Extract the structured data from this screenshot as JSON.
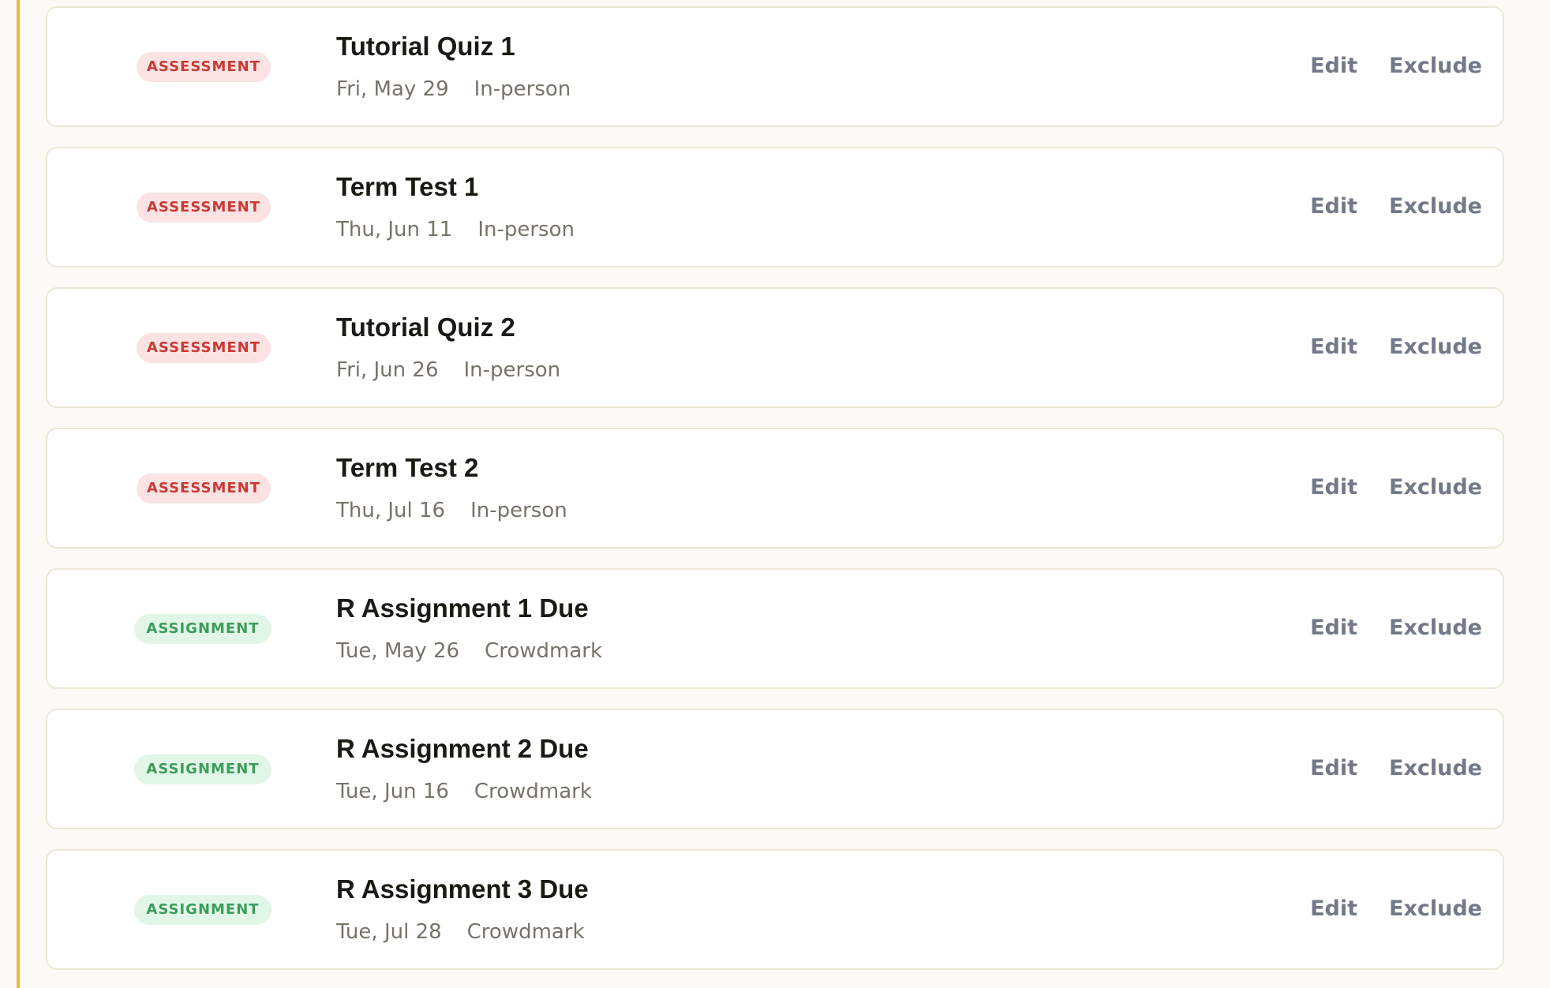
{
  "colors": {
    "accent_rule": "#e6bd3f",
    "assessment_badge_bg": "#fbe3e4",
    "assessment_badge_text": "#c93a34",
    "assignment_badge_bg": "#e2f6e8",
    "assignment_badge_text": "#3b9d5a",
    "action_text": "#727988"
  },
  "events": [
    {
      "type": "assessment",
      "badge": "ASSESSMENT",
      "title": "Tutorial Quiz 1",
      "date": "Fri, May 29",
      "location": "In-person",
      "edit_label": "Edit",
      "exclude_label": "Exclude"
    },
    {
      "type": "assessment",
      "badge": "ASSESSMENT",
      "title": "Term Test 1",
      "date": "Thu, Jun 11",
      "location": "In-person",
      "edit_label": "Edit",
      "exclude_label": "Exclude"
    },
    {
      "type": "assessment",
      "badge": "ASSESSMENT",
      "title": "Tutorial Quiz 2",
      "date": "Fri, Jun 26",
      "location": "In-person",
      "edit_label": "Edit",
      "exclude_label": "Exclude"
    },
    {
      "type": "assessment",
      "badge": "ASSESSMENT",
      "title": "Term Test 2",
      "date": "Thu, Jul 16",
      "location": "In-person",
      "edit_label": "Edit",
      "exclude_label": "Exclude"
    },
    {
      "type": "assignment",
      "badge": "ASSIGNMENT",
      "title": "R Assignment 1 Due",
      "date": "Tue, May 26",
      "location": "Crowdmark",
      "edit_label": "Edit",
      "exclude_label": "Exclude"
    },
    {
      "type": "assignment",
      "badge": "ASSIGNMENT",
      "title": "R Assignment 2 Due",
      "date": "Tue, Jun 16",
      "location": "Crowdmark",
      "edit_label": "Edit",
      "exclude_label": "Exclude"
    },
    {
      "type": "assignment",
      "badge": "ASSIGNMENT",
      "title": "R Assignment 3 Due",
      "date": "Tue, Jul 28",
      "location": "Crowdmark",
      "edit_label": "Edit",
      "exclude_label": "Exclude"
    }
  ]
}
